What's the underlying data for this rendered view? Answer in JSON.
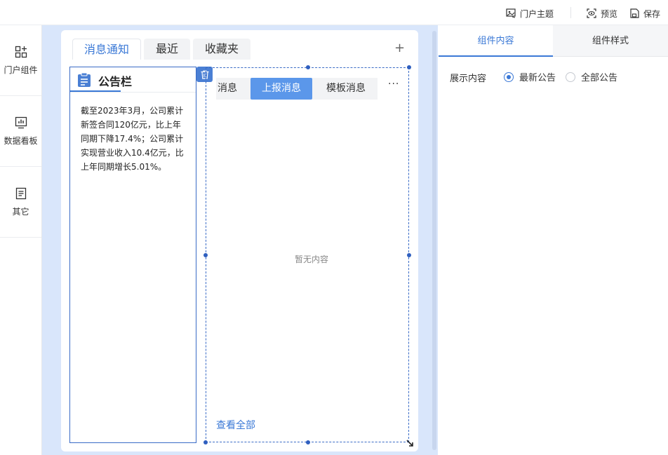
{
  "topbar": {
    "theme_label": "门户主题",
    "preview_label": "预览",
    "save_label": "保存"
  },
  "sidebar": {
    "items": [
      {
        "label": "门户组件",
        "icon": "components-icon"
      },
      {
        "label": "数据看板",
        "icon": "dashboard-icon"
      },
      {
        "label": "其它",
        "icon": "document-icon"
      }
    ]
  },
  "page_tabs": [
    {
      "label": "消息通知",
      "active": true
    },
    {
      "label": "最近",
      "active": false
    },
    {
      "label": "收藏夹",
      "active": false
    }
  ],
  "add_tab_label": "+",
  "notice_widget": {
    "title": "公告栏",
    "body": "截至2023年3月，公司累计新签合同120亿元，比上年同期下降17.4%；公司累计实现营业收入10.4亿元，比上年同期增长5.01%。"
  },
  "message_widget": {
    "tabs": [
      {
        "label": "消息",
        "active": false
      },
      {
        "label": "上报消息",
        "active": true
      },
      {
        "label": "模板消息",
        "active": false
      }
    ],
    "more_label": "···",
    "empty_text": "暂无内容",
    "view_all_label": "查看全部"
  },
  "right_panel": {
    "tabs": [
      {
        "label": "组件内容",
        "active": true
      },
      {
        "label": "组件样式",
        "active": false
      }
    ],
    "display_label": "展示内容",
    "options": [
      {
        "label": "最新公告",
        "selected": true
      },
      {
        "label": "全部公告",
        "selected": false
      }
    ]
  },
  "colors": {
    "accent": "#3a78d6",
    "canvas_bg": "#d9e6fb",
    "active_msg_tab": "#5b97ea"
  }
}
